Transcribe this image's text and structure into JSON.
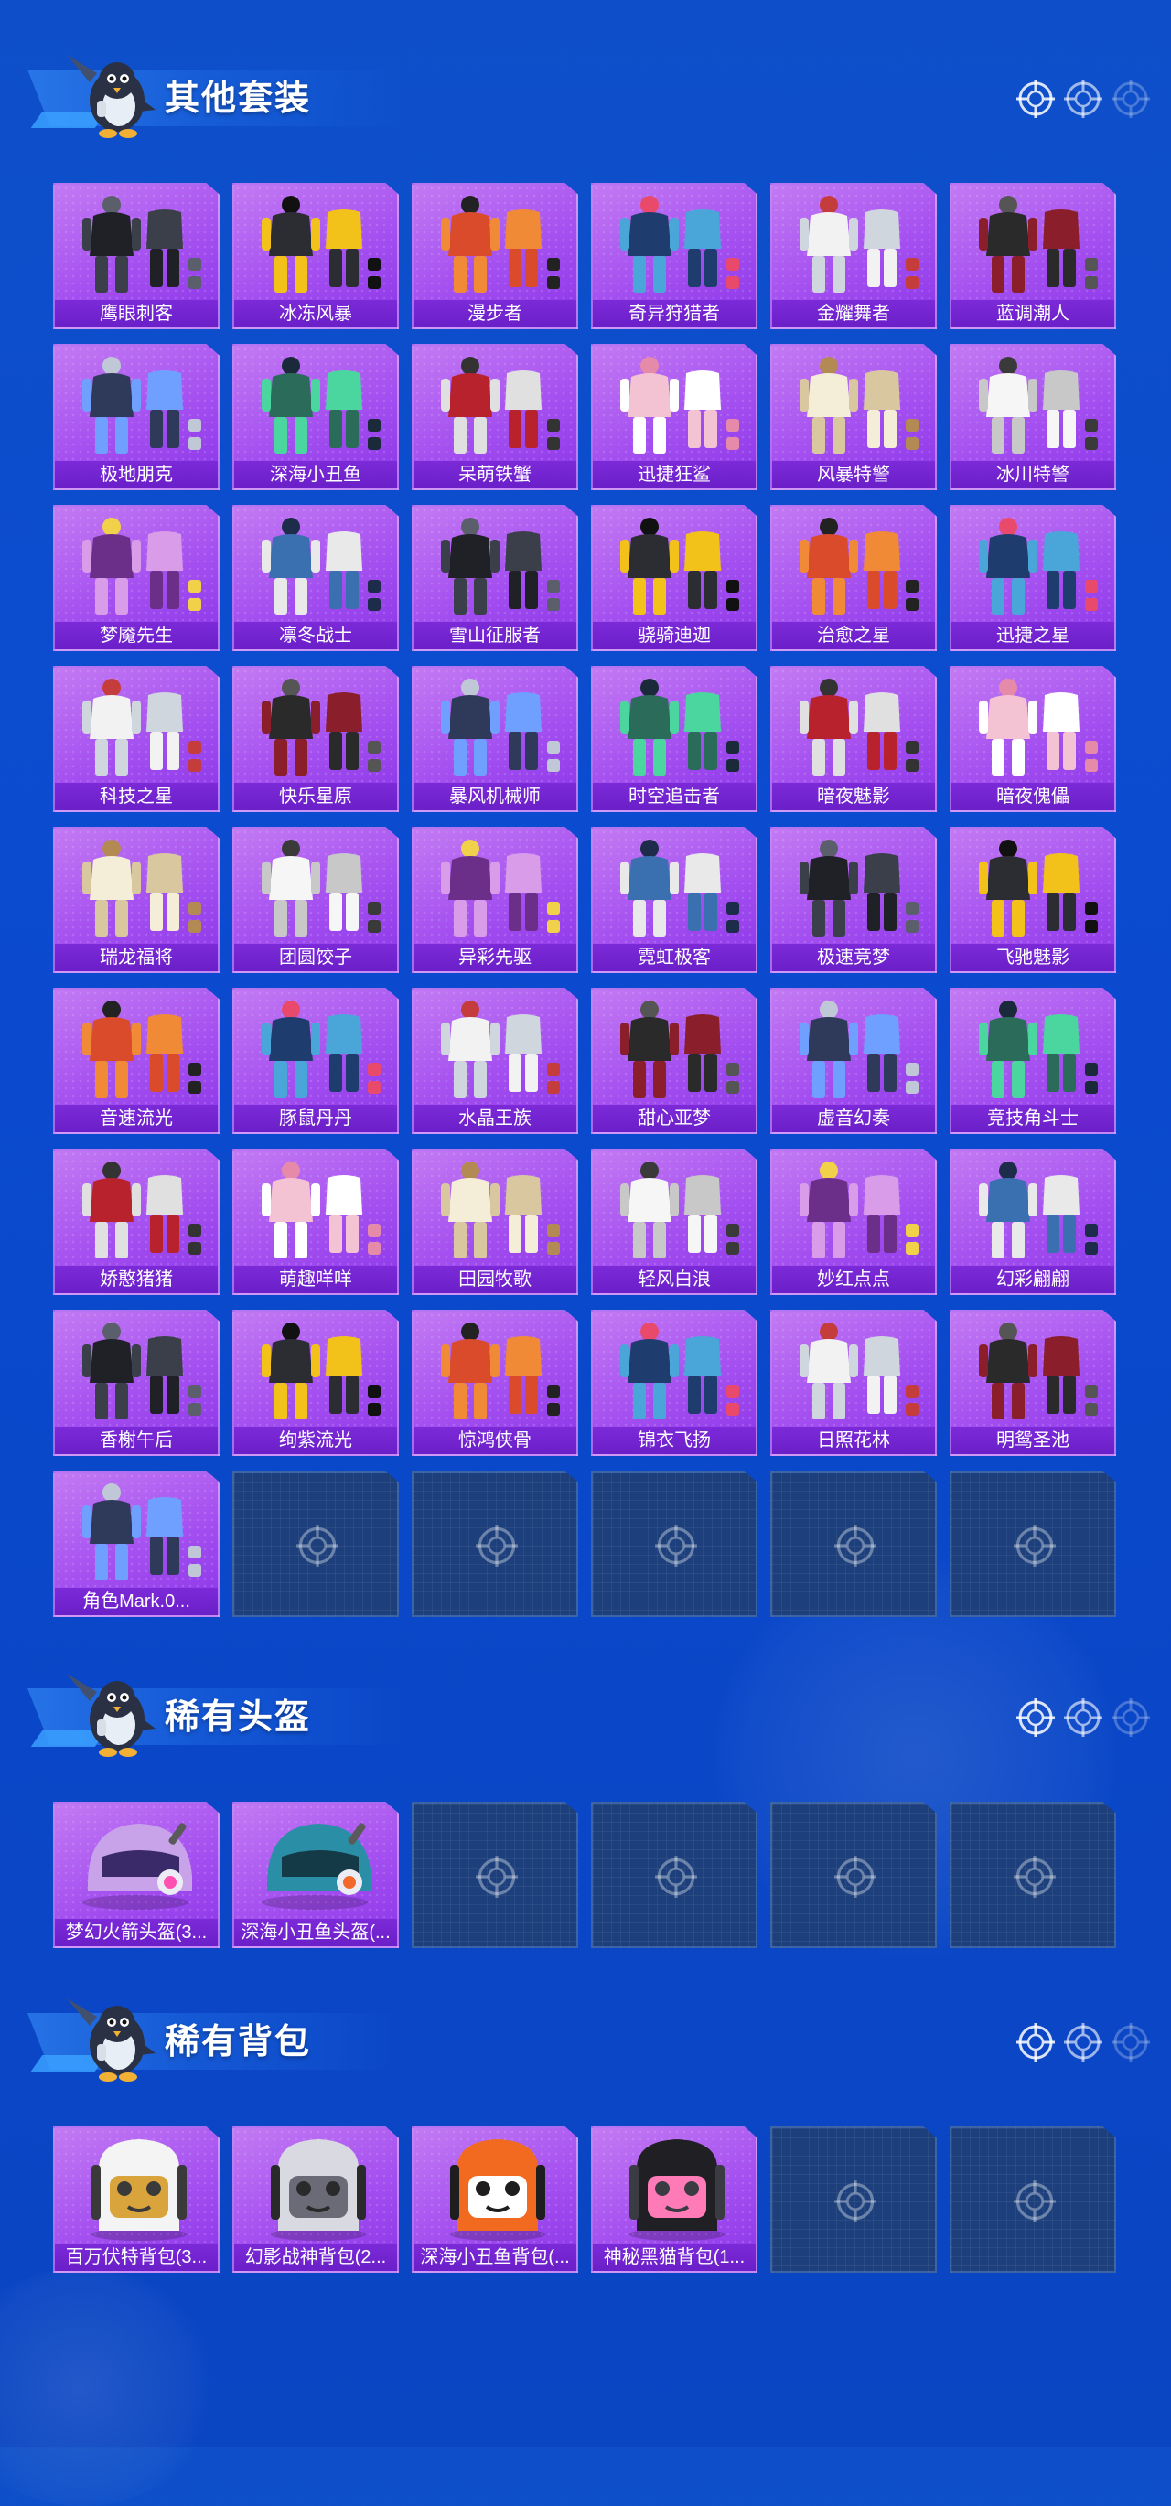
{
  "sections": [
    {
      "title": "其他套装",
      "items": [
        "鹰眼刺客",
        "冰冻风暴",
        "漫步者",
        "奇异狩猎者",
        "金耀舞者",
        "蓝调潮人",
        "极地朋克",
        "深海小丑鱼",
        "呆萌铁蟹",
        "迅捷狂鲨",
        "风暴特警",
        "冰川特警",
        "梦魇先生",
        "凛冬战士",
        "雪山征服者",
        "骁骑迪迦",
        "治愈之星",
        "迅捷之星",
        "科技之星",
        "快乐星原",
        "暴风机械师",
        "时空追击者",
        "暗夜魅影",
        "暗夜傀儡",
        "瑞龙福将",
        "团圆饺子",
        "异彩先驱",
        "霓虹极客",
        "极速竞梦",
        "飞驰魅影",
        "音速流光",
        "豚鼠丹丹",
        "水晶王族",
        "甜心亚梦",
        "虚音幻奏",
        "竞技角斗士",
        "娇憨猪猪",
        "萌趣咩咩",
        "田园牧歌",
        "轻风白浪",
        "妙红点点",
        "幻彩翩翩",
        "香榭午后",
        "绚紫流光",
        "惊鸿侠骨",
        "锦衣飞扬",
        "日照花林",
        "明鸳圣池",
        "角色Mark.0..."
      ],
      "empty_slots": 5
    },
    {
      "title": "稀有头盔",
      "items": [
        "梦幻火箭头盔(3...",
        "深海小丑鱼头盔(..."
      ],
      "empty_slots": 4
    },
    {
      "title": "稀有背包",
      "items": [
        "百万伏特背包(3...",
        "幻影战神背包(2...",
        "深海小丑鱼背包(...",
        "神秘黑猫背包(1..."
      ],
      "empty_slots": 2
    }
  ],
  "icons": {
    "mascot": "penguin-mascot-icon",
    "header_marks": "crosshair-icon",
    "empty_slot": "crosshair-icon"
  },
  "colors": {
    "background": "#0b4bd0",
    "card_fill": "#a44ff0",
    "card_label": "#6a1fc8",
    "empty_slot": "#1d3f7c"
  }
}
